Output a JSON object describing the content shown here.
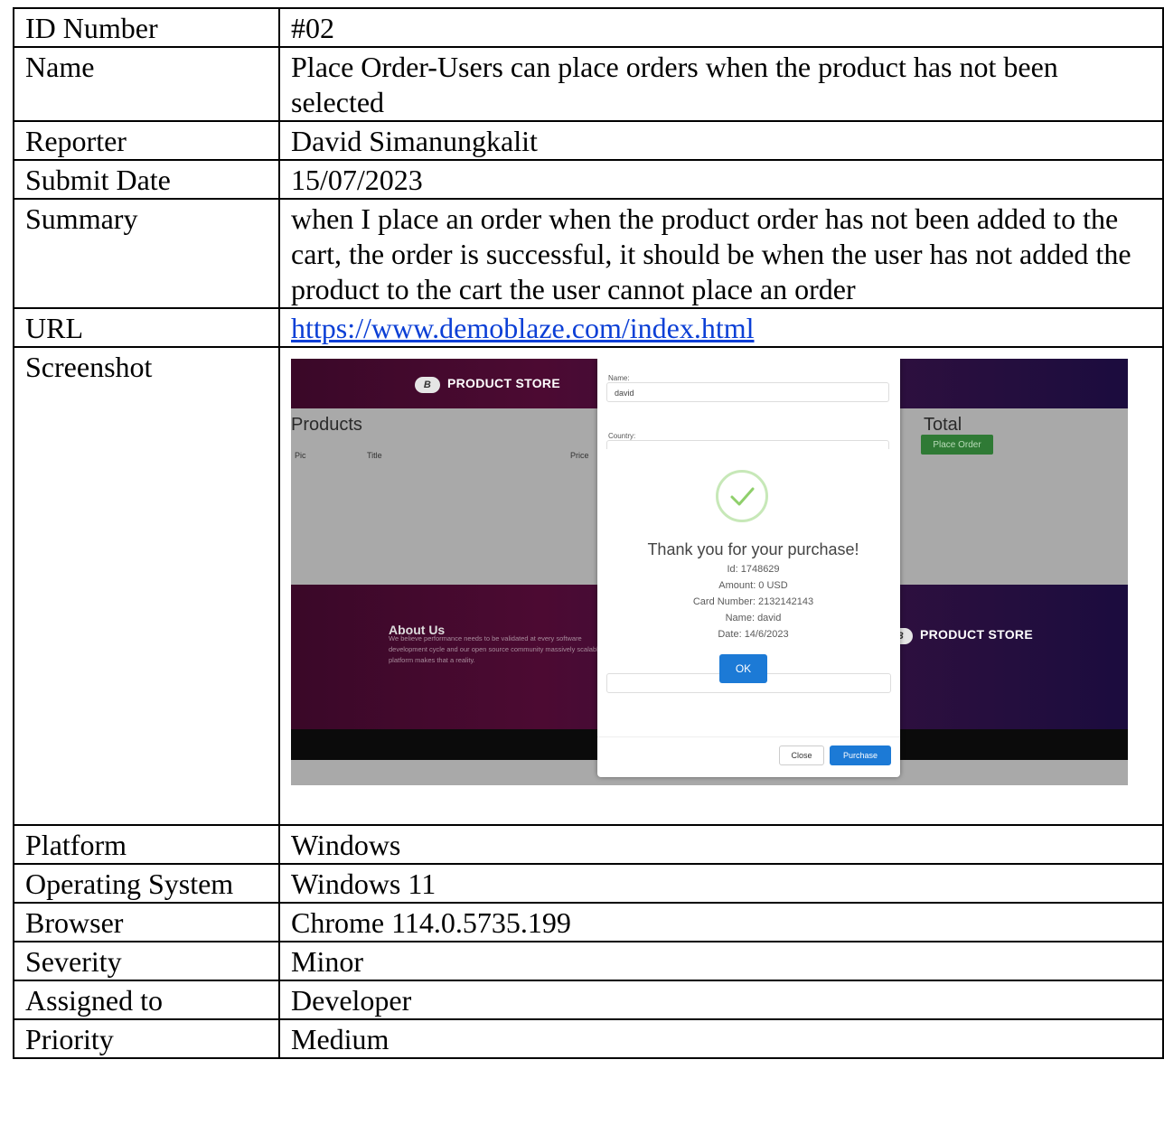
{
  "rows": {
    "id": {
      "label": "ID Number",
      "value": "#02"
    },
    "name": {
      "label": "Name",
      "value": "Place Order-Users can place orders when the product has not been selected"
    },
    "reporter": {
      "label": "Reporter",
      "value": "David Simanungkalit"
    },
    "submit_date": {
      "label": "Submit Date",
      "value": "15/07/2023"
    },
    "summary": {
      "label": "Summary",
      "value": "when I place an order when the product order has not been added to the cart, the order is successful, it should be when the user has not added the product to the cart the user cannot place an order"
    },
    "url": {
      "label": "URL",
      "value": "https://www.demoblaze.com/index.html"
    },
    "screenshot": {
      "label": "Screenshot"
    },
    "platform": {
      "label": "Platform",
      "value": "Windows"
    },
    "os": {
      "label": "Operating System",
      "value": "Windows 11"
    },
    "browser": {
      "label": "Browser",
      "value": "Chrome 114.0.5735.199"
    },
    "severity": {
      "label": "Severity",
      "value": "Minor"
    },
    "assigned": {
      "label": "Assigned to",
      "value": "Developer"
    },
    "priority": {
      "label": "Priority",
      "value": "Medium"
    }
  },
  "screenshot": {
    "brand": "PRODUCT STORE",
    "logo_text": "B",
    "products_heading": "Products",
    "col_pic": "Pic",
    "col_title": "Title",
    "col_price": "Price",
    "total_heading": "Total",
    "place_order_button": "Place Order",
    "about_title": "About Us",
    "about_text": "We believe performance needs to be validated at every software development cycle and our open source community massively scalable platform makes that a reality.",
    "modal": {
      "name_label": "Name:",
      "name_value": "david",
      "country_label": "Country:",
      "close_button": "Close",
      "purchase_button": "Purchase"
    },
    "alert": {
      "title": "Thank you for your purchase!",
      "id": "Id: 1748629",
      "amount": "Amount: 0 USD",
      "card": "Card Number: 2132142143",
      "name": "Name: david",
      "date": "Date: 14/6/2023",
      "ok_button": "OK"
    }
  }
}
